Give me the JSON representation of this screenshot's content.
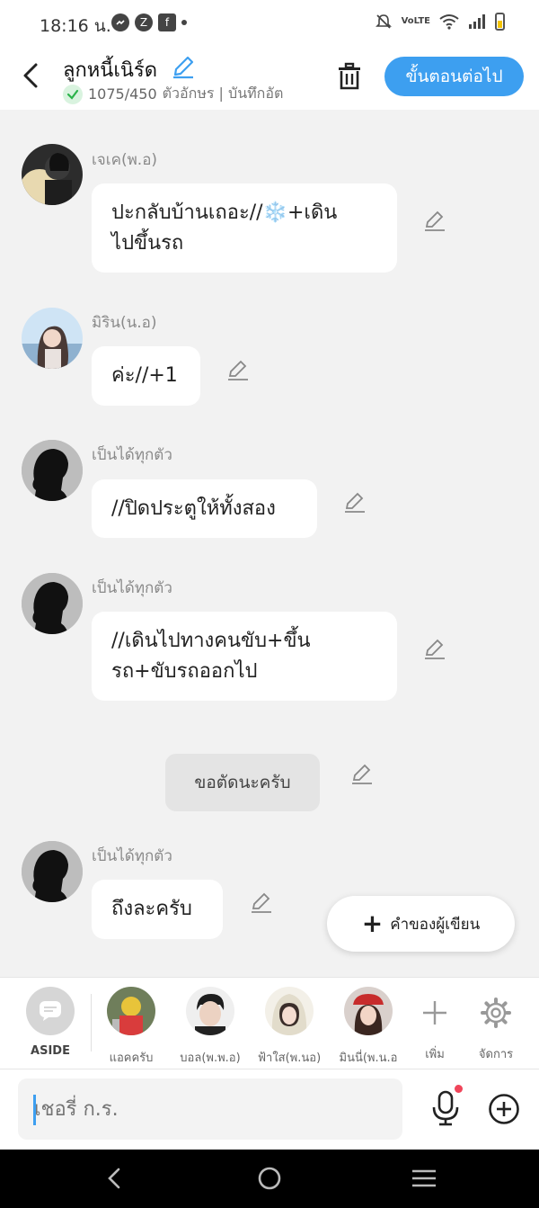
{
  "status_bar": {
    "time": "18:16 น.",
    "left_icons": [
      "messenger-icon",
      "z-icon",
      "facebook-icon",
      "dot"
    ],
    "network_label": "VoLTE",
    "right_icons": [
      "mute-icon",
      "volte-icon",
      "wifi-icon",
      "signal-icon",
      "battery-icon"
    ]
  },
  "header": {
    "title": "ลูกหนี้เนิร์ด",
    "counter": "1075/450",
    "subtitle_rest": "ตัวอักษร | บันทึกอัต",
    "next_button": "ขั้นตอนต่อไป",
    "accent_color": "#3d9ff0"
  },
  "messages": [
    {
      "sender": "เจเค(พ.อ)",
      "line1": "ปะกลับบ้านเถอะ//❄️+เดิน",
      "line2": "ไปขึ้นรถ"
    },
    {
      "sender": "มิริน(น.อ)",
      "line1": "ค่ะ//+1"
    },
    {
      "sender": "เป็นได้ทุกตัว",
      "line1": "//ปิดประตูให้ทั้งสอง"
    },
    {
      "sender": "เป็นได้ทุกตัว",
      "line1": "//เดินไปทางคนขับ+ขึ้น",
      "line2": "รถ+ขับรถออกไป"
    },
    {
      "sender": "เป็นได้ทุกตัว",
      "line1": "ถึงละครับ"
    }
  ],
  "aside_message": "ขอตัดนะครับ",
  "author_note_button": "คำของผู้เขียน",
  "character_bar": {
    "aside_label": "ASIDE",
    "characters": [
      "แอคครับ",
      "บอล(พ.พ.อ)",
      "ฟ้าใส(พ.นอ)",
      "มินนี่(พ.น.อ"
    ],
    "add_label": "เพิ่ม",
    "manage_label": "จัดการ"
  },
  "input": {
    "placeholder": "เชอรี่ ก.ร."
  },
  "nav": {
    "buttons": [
      "back",
      "home",
      "recents"
    ]
  }
}
